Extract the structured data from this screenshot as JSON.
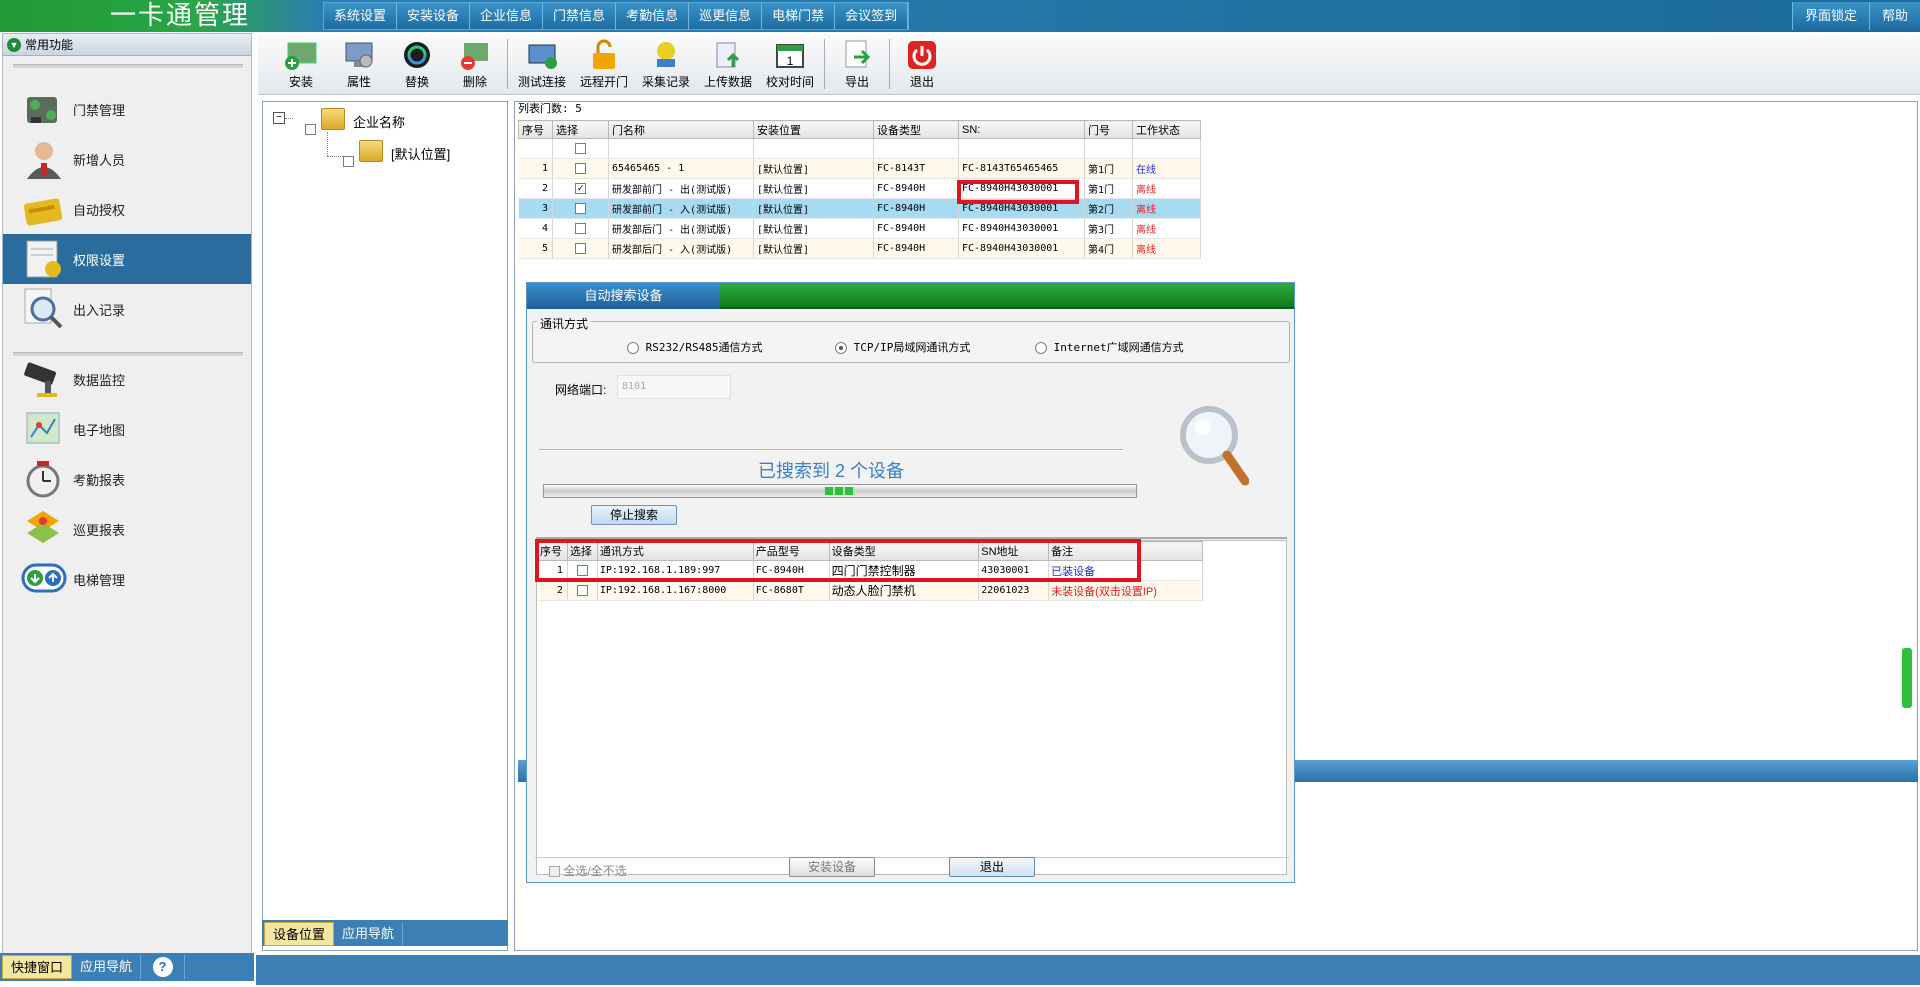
{
  "app": {
    "title": "一卡通管理"
  },
  "topmenu": [
    "系统设置",
    "安装设备",
    "企业信息",
    "门禁信息",
    "考勤信息",
    "巡更信息",
    "电梯门禁",
    "会议签到"
  ],
  "topright": [
    "界面锁定",
    "帮助"
  ],
  "leftpanel": {
    "header": "常用功能",
    "items": [
      {
        "label": "门禁管理",
        "icon": "door-access-icon"
      },
      {
        "label": "新增人员",
        "icon": "person-icon"
      },
      {
        "label": "自动授权",
        "icon": "card-icon"
      },
      {
        "label": "权限设置",
        "icon": "permission-icon",
        "active": true
      },
      {
        "label": "出入记录",
        "icon": "magnifier-icon"
      },
      {
        "label": "数据监控",
        "icon": "camera-icon"
      },
      {
        "label": "电子地图",
        "icon": "map-icon"
      },
      {
        "label": "考勤报表",
        "icon": "clock-icon"
      },
      {
        "label": "巡更报表",
        "icon": "patrol-icon"
      },
      {
        "label": "电梯管理",
        "icon": "elevator-icon"
      }
    ],
    "bottom_tabs": [
      "快捷窗口",
      "应用导航"
    ]
  },
  "toolbar": [
    {
      "label": "安装",
      "icon": "install-icon"
    },
    {
      "label": "属性",
      "icon": "properties-icon"
    },
    {
      "label": "替换",
      "icon": "replace-icon"
    },
    {
      "label": "删除",
      "icon": "delete-icon"
    },
    {
      "label": "测试连接",
      "icon": "test-connection-icon"
    },
    {
      "label": "远程开门",
      "icon": "remote-open-icon"
    },
    {
      "label": "采集记录",
      "icon": "collect-records-icon"
    },
    {
      "label": "上传数据",
      "icon": "upload-icon"
    },
    {
      "label": "校对时间",
      "icon": "calendar-icon"
    },
    {
      "label": "导出",
      "icon": "export-icon"
    },
    {
      "label": "退出",
      "icon": "power-icon"
    }
  ],
  "tree": {
    "root": "企业名称",
    "child": "[默认位置]",
    "tabs": [
      "设备位置",
      "应用导航"
    ]
  },
  "doorlist": {
    "count_label": "列表门数: 5",
    "columns": [
      "序号",
      "选择",
      "门名称",
      "安装位置",
      "设备类型",
      "SN:",
      "门号",
      "工作状态"
    ],
    "rows": [
      {
        "no": "1",
        "checked": false,
        "name": "65465465 - 1",
        "location": "[默认位置]",
        "type": "FC-8143T",
        "sn": "FC-8143T65465465",
        "door": "第1门",
        "status": "在线",
        "online": true
      },
      {
        "no": "2",
        "checked": true,
        "name": "研发部前门 - 出(测试版)",
        "location": "[默认位置]",
        "type": "FC-8940H",
        "sn": "FC-8940H43030001",
        "door": "第1门",
        "status": "离线",
        "online": false
      },
      {
        "no": "3",
        "checked": false,
        "name": "研发部前门 - 入(测试版)",
        "location": "[默认位置]",
        "type": "FC-8940H",
        "sn": "FC-8940H43030001",
        "door": "第2门",
        "status": "离线",
        "online": false
      },
      {
        "no": "4",
        "checked": false,
        "name": "研发部后门 - 出(测试版)",
        "location": "[默认位置]",
        "type": "FC-8940H",
        "sn": "FC-8940H43030001",
        "door": "第3门",
        "status": "离线",
        "online": false
      },
      {
        "no": "5",
        "checked": false,
        "name": "研发部后门 - 入(测试版)",
        "location": "[默认位置]",
        "type": "FC-8940H",
        "sn": "FC-8940H43030001",
        "door": "第4门",
        "status": "离线",
        "online": false
      }
    ]
  },
  "dialog": {
    "tab": "自动搜索设备",
    "comm_group": "通讯方式",
    "comm_options": [
      "RS232/RS485通信方式",
      "TCP/IP局域网通讯方式",
      "Internet广域网通信方式"
    ],
    "comm_selected": 1,
    "port_label": "网络端口:",
    "port_value": "8101",
    "search_status": "已搜索到  2 个设备",
    "progress": 0.5,
    "stop_button": "停止搜索",
    "columns": [
      "序号",
      "选择",
      "通讯方式",
      "产品型号",
      "设备类型",
      "SN地址",
      "备注"
    ],
    "rows": [
      {
        "no": "1",
        "comm": "IP:192.168.1.189:997",
        "model": "FC-8940H",
        "type": "四门门禁控制器",
        "sn": "43030001",
        "note": "已装设备",
        "installed": true
      },
      {
        "no": "2",
        "comm": "IP:192.168.1.167:8000",
        "model": "FC-8680T",
        "type": "动态人脸门禁机",
        "sn": "22061023",
        "note": "未装设备(双击设置IP)",
        "installed": false
      }
    ],
    "select_all": "全选/全不选",
    "install_button": "安装设备",
    "exit_button": "退出"
  },
  "colors": {
    "accent": "#2a6c9d",
    "online": "#1f2fd0",
    "offline": "#e02222",
    "highlight_box": "#e0141f"
  }
}
